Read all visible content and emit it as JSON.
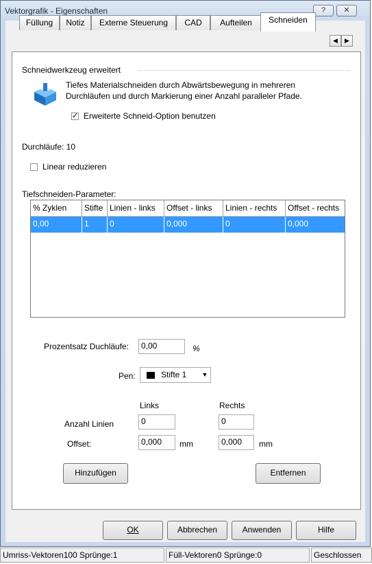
{
  "window": {
    "title": "Vektorgrafik - Eigenschaften",
    "help_btn": "?",
    "close_btn": "✕"
  },
  "tabs": [
    "Füllung",
    "Notiz",
    "Externe Steuerung",
    "CAD",
    "Aufteilen",
    "Schneiden"
  ],
  "active_tab": "Schneiden",
  "tab_scroll": {
    "left": "◀",
    "right": "▶"
  },
  "group": {
    "title": "Schneidwerkzeug erweitert",
    "description_line1": "Tiefes Materialschneiden durch Abwärtsbewegung in mehreren",
    "description_line2": "Durchläufen und durch Markierung einer Anzahl paralleler Pfade.",
    "extended_option_label": "Erweiterte Schneid-Option benutzen",
    "extended_option_checked": true
  },
  "passes_label": "Durchläufe: 10",
  "linear_reduce": {
    "label": "Linear reduzieren",
    "checked": false
  },
  "table": {
    "title": "Tiefschneiden-Parameter:",
    "columns": [
      "% Zyklen",
      "Stifte",
      "Linien - links",
      "Offset - links",
      "Linien - rechts",
      "Offset - rechts"
    ],
    "rows": [
      [
        "0,00",
        "1",
        "0",
        "0,000",
        "0",
        "0,000"
      ]
    ]
  },
  "form": {
    "percent_label": "Prozentsatz Duchläufe:",
    "percent_value": "0,00",
    "percent_unit": "%",
    "pen_label": "Pen:",
    "pen_value": "Stifte 1",
    "left_header": "Links",
    "right_header": "Rechts",
    "lines_label": "Anzahl Linien",
    "lines_left": "0",
    "lines_right": "0",
    "offset_label": "Offset:",
    "offset_left": "0,000",
    "offset_right": "0,000",
    "unit_mm": "mm",
    "add_button": "Hinzufügen",
    "remove_button": "Entfernen"
  },
  "footer": {
    "ok": "OK",
    "cancel": "Abbrechen",
    "apply": "Anwenden",
    "help": "Hilfe"
  },
  "statusbar": [
    "Umriss-Vektoren100  Sprünge:1",
    "Füll-Vektoren0  Sprünge:0",
    "Geschlossen"
  ],
  "colors": {
    "selection": "#3399ff",
    "title_gradient": "#c9d9ee"
  }
}
